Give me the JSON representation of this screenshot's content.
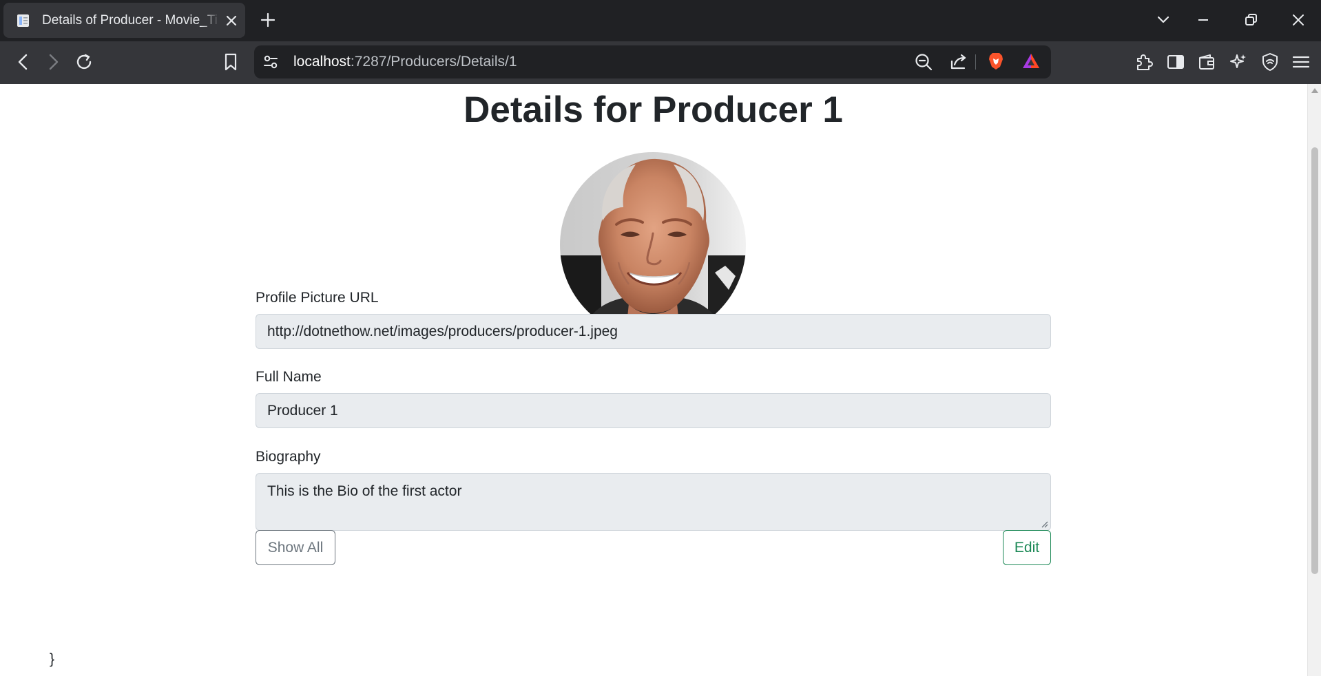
{
  "browser": {
    "tab_title": "Details of Producer - Movie_Tickets",
    "url_host": "localhost",
    "url_path": ":7287/Producers/Details/1"
  },
  "page": {
    "title": "Details for Producer 1",
    "profile_picture": {
      "label": "Profile Picture URL",
      "value": "http://dotnethow.net/images/producers/producer-1.jpeg"
    },
    "full_name": {
      "label": "Full Name",
      "value": "Producer 1"
    },
    "biography": {
      "label": "Biography",
      "value": "This is the Bio of the first actor"
    },
    "buttons": {
      "show_all": "Show All",
      "edit": "Edit"
    },
    "stray_text": "}"
  },
  "colors": {
    "edit_button": "#198754",
    "show_all_button": "#6c757d",
    "field_background": "#e9ecef"
  }
}
